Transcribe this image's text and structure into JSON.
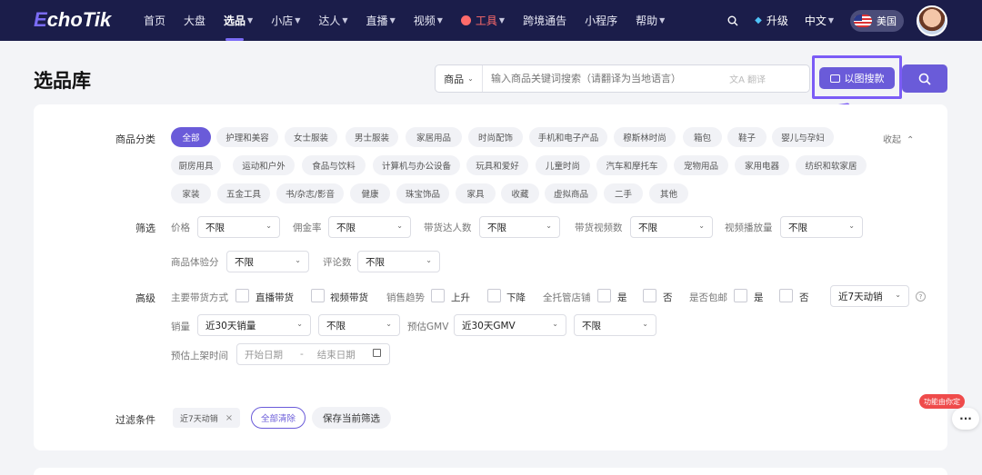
{
  "nav": {
    "logo": "EchoTik",
    "items": [
      {
        "label": "首页"
      },
      {
        "label": "大盘"
      },
      {
        "label": "选品"
      },
      {
        "label": "小店"
      },
      {
        "label": "达人"
      },
      {
        "label": "直播"
      },
      {
        "label": "视频"
      },
      {
        "label": "工具"
      },
      {
        "label": "跨境通告"
      },
      {
        "label": "小程序"
      },
      {
        "label": "帮助"
      }
    ],
    "upgrade": "升级",
    "language": "中文",
    "region": "美国"
  },
  "page": {
    "title": "选品库"
  },
  "search": {
    "type_select": "商品",
    "placeholder": "输入商品关键词搜索（请翻译为当地语言）",
    "translate": "翻译",
    "image_search": "以图搜款"
  },
  "filters": {
    "category_label": "商品分类",
    "collapse": "收起",
    "categories": [
      "全部",
      "护理和美容",
      "女士服装",
      "男士服装",
      "家居用品",
      "时尚配饰",
      "手机和电子产品",
      "穆斯林时尚",
      "箱包",
      "鞋子",
      "婴儿与孕妇",
      "厨房用具",
      "运动和户外",
      "食品与饮料",
      "计算机与办公设备",
      "玩具和爱好",
      "儿童时尚",
      "汽车和摩托车",
      "宠物用品",
      "家用电器",
      "纺织和软家居",
      "家装",
      "五金工具",
      "书/杂志/影音",
      "健康",
      "珠宝饰品",
      "家具",
      "收藏",
      "虚拟商品",
      "二手",
      "其他"
    ],
    "screen_label": "筛选",
    "screen": [
      {
        "label": "价格",
        "value": "不限"
      },
      {
        "label": "佣金率",
        "value": "不限"
      },
      {
        "label": "带货达人数",
        "value": "不限"
      },
      {
        "label": "带货视频数",
        "value": "不限"
      },
      {
        "label": "视频播放量",
        "value": "不限"
      },
      {
        "label": "商品体验分",
        "value": "不限"
      },
      {
        "label": "评论数",
        "value": "不限"
      }
    ],
    "advanced_label": "高级",
    "advanced": {
      "main_mode_label": "主要带货方式",
      "live": "直播带货",
      "video": "视频带货",
      "trend_label": "销售趋势",
      "up": "上升",
      "down": "下降",
      "fully_managed_label": "全托管店铺",
      "yes1": "是",
      "no1": "否",
      "free_ship_label": "是否包邮",
      "yes2": "是",
      "no2": "否",
      "period": "近7天动销",
      "sales_label": "销量",
      "sales_period": "近30天销量",
      "sales_value": "不限",
      "gmv_label": "预估GMV",
      "gmv_period": "近30天GMV",
      "gmv_value": "不限",
      "listing_label": "预估上架时间",
      "start_date": "开始日期",
      "date_sep": "-",
      "end_date": "结束日期"
    },
    "conditions_label": "过滤条件",
    "active_tag": "近7天动销",
    "clear_all": "全部清除",
    "save": "保存当前筛选"
  },
  "floating": {
    "badge": "功能由你定",
    "more": "···"
  }
}
